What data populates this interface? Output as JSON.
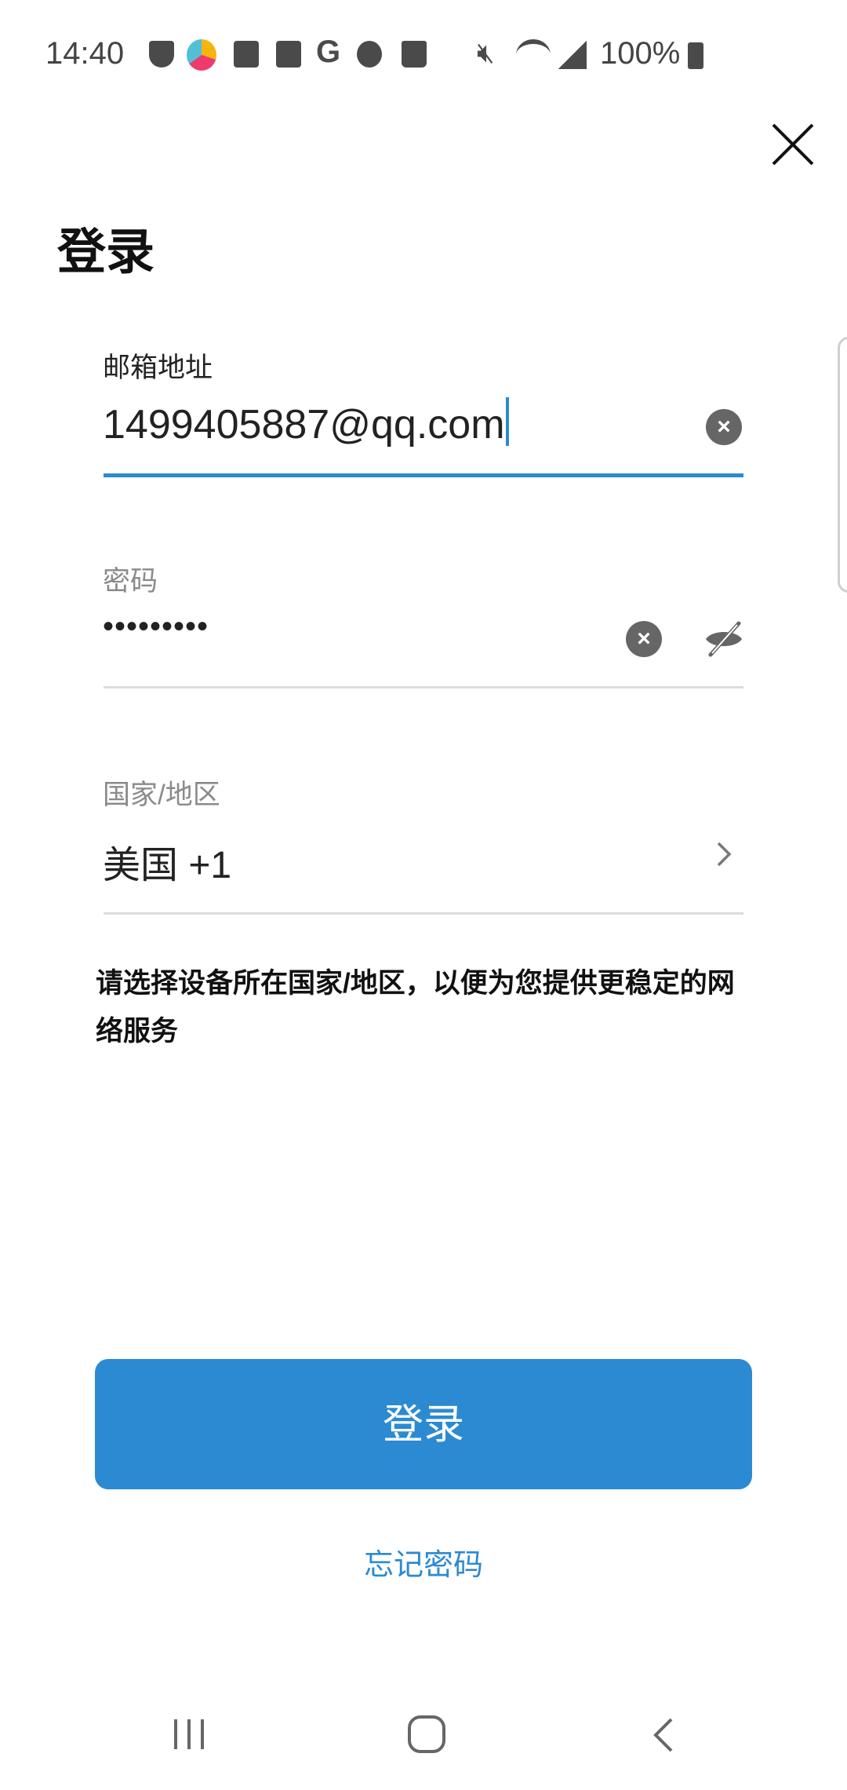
{
  "status_bar": {
    "time": "14:40",
    "battery": "100%",
    "icons": [
      "shield-alert-icon",
      "app-logo-icon",
      "checkbox-icon",
      "back-arrow-icon",
      "google-icon",
      "planet-icon",
      "shopping-bag-icon",
      "mute-icon",
      "wifi-icon",
      "signal-icon",
      "battery-icon"
    ]
  },
  "header": {
    "title": "登录",
    "close_icon": "close-icon"
  },
  "form": {
    "email": {
      "label": "邮箱地址",
      "value": "1499405887@qq.com"
    },
    "password": {
      "label": "密码",
      "value": "•••••••••"
    },
    "country": {
      "label": "国家/地区",
      "value": "美国 +1"
    }
  },
  "notice": "请选择设备所在国家/地区，以便为您提供更稳定的网络服务",
  "login_button": "登录",
  "forgot_password": "忘记密码",
  "colors": {
    "accent": "#2b8ad2",
    "divider": "#dcdcdc",
    "label_gray": "#8a8a8a"
  }
}
